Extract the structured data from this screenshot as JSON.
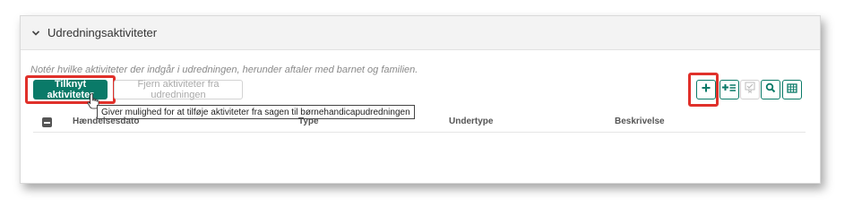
{
  "panel": {
    "title": "Udredningsaktiviteter",
    "hint": "Notér hvilke aktiviteter der indgår i udredningen, herunder aftaler med barnet og familien."
  },
  "actions": {
    "attach_label": "Tilknyt aktiviteter",
    "remove_label": "Fjern aktiviteter fra udredningen",
    "attach_tooltip": "Giver mulighed for at tilføje aktiviteter fra sagen til børnehandicapudredningen"
  },
  "toolbar": {
    "icons": [
      "plus-icon",
      "add-list-icon",
      "checklist-icon",
      "search-icon",
      "table-icon"
    ]
  },
  "table": {
    "columns": [
      "Hændelsesdato",
      "Type",
      "Undertype",
      "Beskrivelse"
    ]
  },
  "colors": {
    "accent": "#0a7a68",
    "highlight": "#e0302a"
  }
}
